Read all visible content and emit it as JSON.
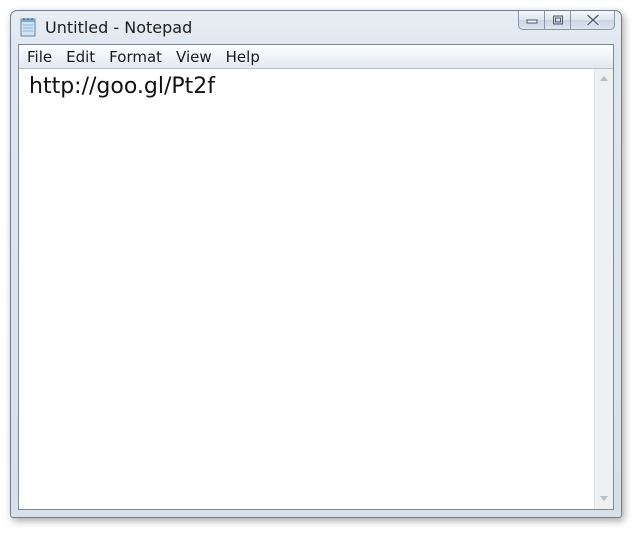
{
  "window": {
    "title": "Untitled - Notepad",
    "app_icon": "notepad-icon"
  },
  "caption_buttons": {
    "minimize_icon": "minimize-icon",
    "maximize_icon": "restore-icon",
    "close_icon": "close-icon"
  },
  "menu": {
    "items": [
      {
        "label": "File"
      },
      {
        "label": "Edit"
      },
      {
        "label": "Format"
      },
      {
        "label": "View"
      },
      {
        "label": "Help"
      }
    ]
  },
  "editor": {
    "content": "http://goo.gl/Pt2f"
  },
  "scrollbar": {
    "up_icon": "scroll-up-arrow-icon",
    "down_icon": "scroll-down-arrow-icon"
  },
  "colors": {
    "window_frame": "#dfe6ee",
    "menubar": "#eef2f7",
    "editor_bg": "#ffffff",
    "text": "#111111"
  }
}
